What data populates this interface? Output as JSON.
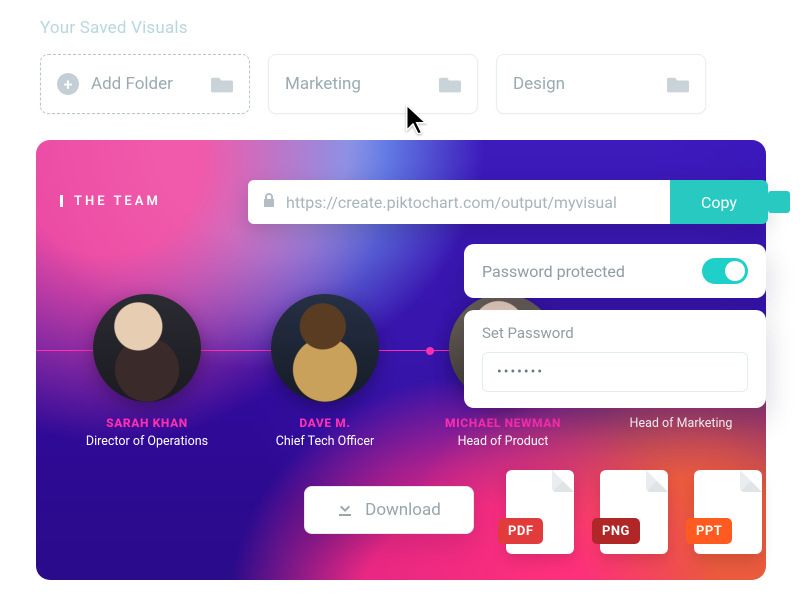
{
  "top_label": "Your Saved Visuals",
  "folders": {
    "add_label": "Add Folder",
    "items": [
      "Marketing",
      "Design"
    ]
  },
  "section_title": "THE TEAM",
  "share": {
    "url": "https://create.piktochart.com/output/myvisual",
    "copy_label": "Copy"
  },
  "password": {
    "toggle_label": "Password protected",
    "toggle_on": true,
    "set_label": "Set Password",
    "masked_value": "•••••••"
  },
  "download_label": "Download",
  "file_badges": [
    "PDF",
    "PNG",
    "PPT"
  ],
  "team": [
    {
      "name": "SARAH KHAN",
      "role": "Director of Operations"
    },
    {
      "name": "DAVE M.",
      "role": "Chief Tech Officer"
    },
    {
      "name": "MICHAEL NEWMAN",
      "role": "Head of Product"
    },
    {
      "name": "",
      "role": "Head of Marketing"
    }
  ]
}
